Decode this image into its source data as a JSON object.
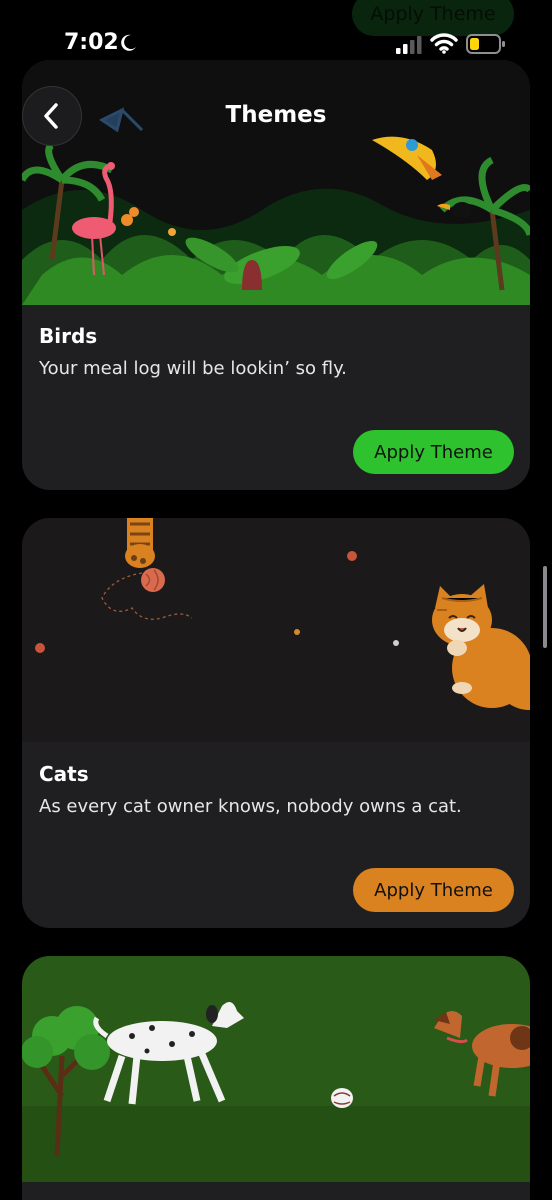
{
  "status_bar": {
    "time": "7:02"
  },
  "header": {
    "title": "Themes"
  },
  "ghost_button": {
    "label": "Apply Theme"
  },
  "themes": [
    {
      "title": "Birds",
      "description": "Your meal log will be lookin’ so fly.",
      "button_label": "Apply Theme",
      "accent": "#2ec22e"
    },
    {
      "title": "Cats",
      "description": "As every cat owner knows, nobody owns a cat.",
      "button_label": "Apply Theme",
      "accent": "#d9821f"
    },
    {
      "title": "",
      "description": "",
      "button_label": "",
      "accent": "#2a5a18"
    }
  ],
  "icons": {
    "back": "back-arrow-icon",
    "moon": "moon-icon",
    "signal": "cellular-signal-icon",
    "wifi": "wifi-icon",
    "battery": "battery-icon"
  },
  "colors": {
    "background": "#000000",
    "card": "#1f1f22",
    "birds_button": "#2ec22e",
    "cats_button": "#d9821f"
  }
}
